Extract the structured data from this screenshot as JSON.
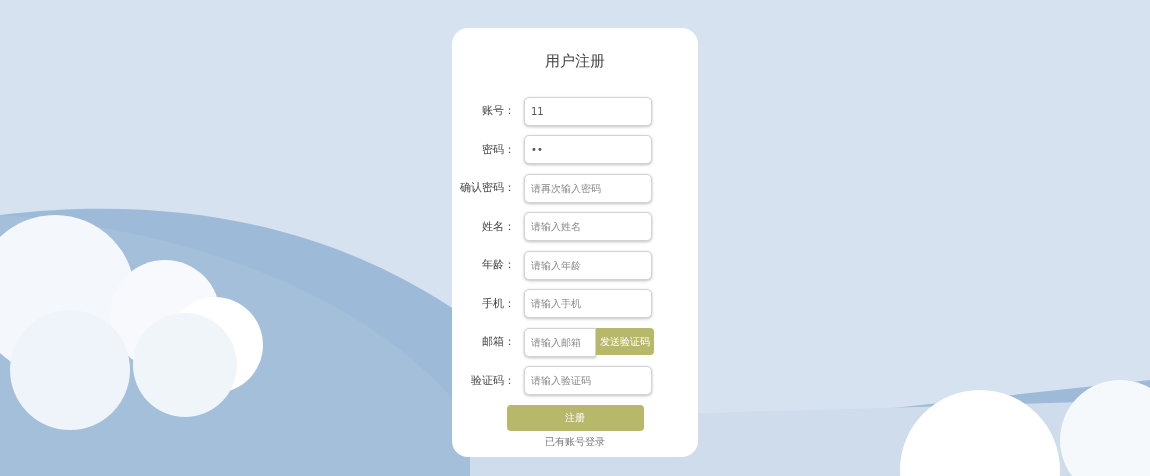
{
  "title": "用户注册",
  "fields": [
    {
      "kind": "text",
      "label": "账号：",
      "value": "11"
    },
    {
      "kind": "text",
      "label": "密码：",
      "value": "••"
    },
    {
      "kind": "text",
      "label": "确认密码：",
      "placeholder": "请再次输入密码"
    },
    {
      "kind": "text",
      "label": "姓名：",
      "placeholder": "请输入姓名"
    },
    {
      "kind": "text",
      "label": "年龄：",
      "placeholder": "请输入年龄"
    },
    {
      "kind": "text",
      "label": "手机：",
      "placeholder": "请输入手机"
    },
    {
      "kind": "email",
      "label": "邮箱：",
      "placeholder": "请输入邮箱",
      "button": "发送验证码"
    },
    {
      "kind": "text",
      "label": "验证码：",
      "placeholder": "请输入验证码"
    }
  ],
  "submit": "注册",
  "login_link": "已有账号登录"
}
